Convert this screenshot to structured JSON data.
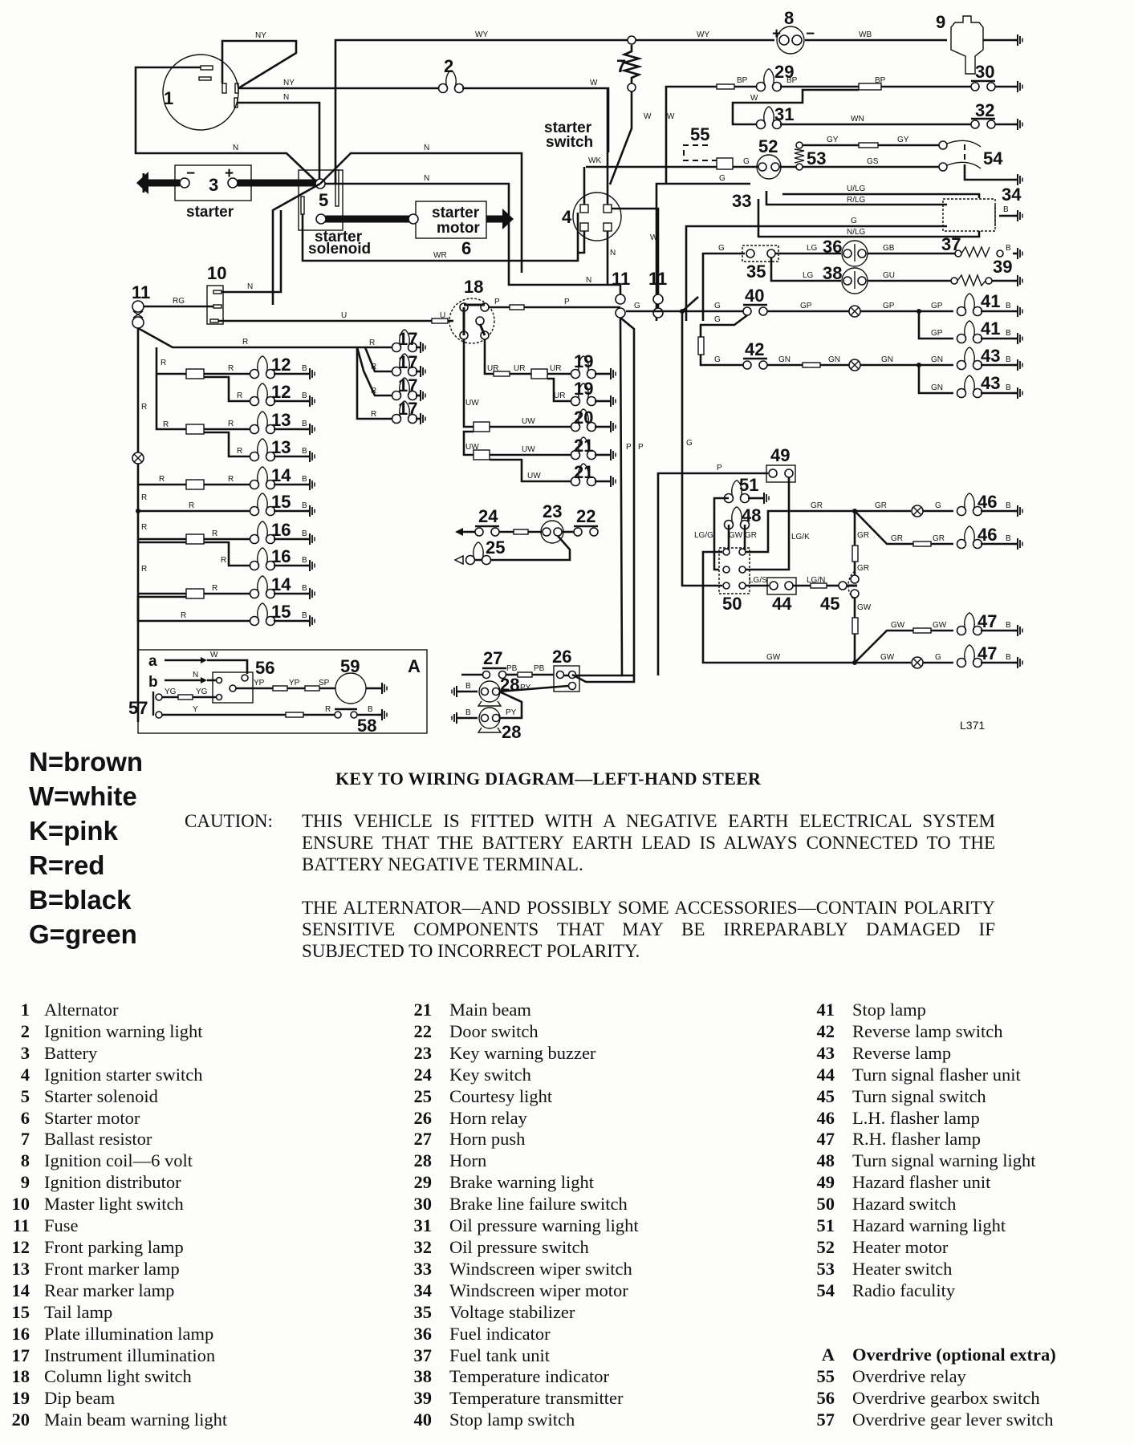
{
  "diagram": {
    "id_mark": "L371",
    "components": {
      "n1": "1",
      "n2": "2",
      "n3": "3",
      "n4": "4",
      "n5": "5",
      "n6": "6",
      "n7": "7",
      "n8": "8",
      "n9": "9",
      "n10": "10",
      "n11": "11",
      "n12": "12",
      "n13": "13",
      "n14": "14",
      "n15": "15",
      "n16": "16",
      "n17": "17",
      "n18": "18",
      "n19": "19",
      "n20": "20",
      "n21": "21",
      "n22": "22",
      "n23": "23",
      "n24": "24",
      "n25": "25",
      "n26": "26",
      "n27": "27",
      "n28": "28",
      "n29": "29",
      "n30": "30",
      "n31": "31",
      "n32": "32",
      "n33": "33",
      "n34": "34",
      "n35": "35",
      "n36": "36",
      "n37": "37",
      "n38": "38",
      "n39": "39",
      "n40": "40",
      "n41": "41",
      "n42": "42",
      "n43": "43",
      "n44": "44",
      "n45": "45",
      "n46": "46",
      "n47": "47",
      "n48": "48",
      "n49": "49",
      "n50": "50",
      "n51": "51",
      "n52": "52",
      "n53": "53",
      "n54": "54",
      "n55": "55",
      "n56": "56",
      "n57": "57",
      "n58": "58",
      "n59": "59",
      "A": "A",
      "a": "a",
      "b": "b"
    },
    "labels": {
      "starter": "starter",
      "starter_solenoid_1": "starter",
      "starter_solenoid_2": "solenoid",
      "starter_motor_1": "starter",
      "starter_motor_2": "motor",
      "starter_switch_1": "starter",
      "starter_switch_2": "switch",
      "plus": "+",
      "minus": "−"
    },
    "wire_codes": {
      "NY": "NY",
      "N": "N",
      "WY": "WY",
      "WB": "WB",
      "W": "W",
      "WK": "WK",
      "WR": "WR",
      "RG": "RG",
      "U": "U",
      "R": "R",
      "P": "P",
      "B": "B",
      "UR": "UR",
      "UW": "UW",
      "BP": "BP",
      "WN": "WN",
      "GY": "GY",
      "GS": "GS",
      "G": "G",
      "ULG": "U/LG",
      "RLG": "R/LG",
      "NLG": "N/LG",
      "LG": "LG",
      "GB": "GB",
      "GU": "GU",
      "GP": "GP",
      "GN": "GN",
      "GR": "GR",
      "GW": "GW",
      "LGG": "LG/G",
      "LGK": "LG/K",
      "LGS": "LG/S",
      "LGN": "LG/N",
      "PB": "PB",
      "PY": "PY",
      "YG": "YG",
      "YP": "YP",
      "SP": "SP",
      "Y": "Y"
    }
  },
  "legend": [
    {
      "code": "N",
      "color": "brown",
      "text": "N=brown"
    },
    {
      "code": "W",
      "color": "white",
      "text": "W=white"
    },
    {
      "code": "K",
      "color": "pink",
      "text": "K=pink"
    },
    {
      "code": "R",
      "color": "red",
      "text": "R=red"
    },
    {
      "code": "B",
      "color": "black",
      "text": "B=black"
    },
    {
      "code": "G",
      "color": "green",
      "text": "G=green"
    }
  ],
  "key": {
    "title": "KEY TO WIRING DIAGRAM—LEFT-HAND STEER",
    "caution_label": "CAUTION:",
    "caution_1": "THIS VEHICLE IS FITTED WITH A NEGATIVE EARTH ELECTRICAL SYSTEM  ENSURE THAT THE BATTERY EARTH LEAD IS ALWAYS CONNECTED TO THE BATTERY NEGATIVE TERMINAL.",
    "caution_2": "THE ALTERNATOR—AND POSSIBLY SOME ACCESSORIES—CONTAIN POLARITY SENSITIVE COMPONENTS THAT MAY BE IRREPARABLY DAMAGED IF SUBJECTED TO INCORRECT POLARITY.",
    "col1": [
      {
        "n": "1",
        "t": "Alternator"
      },
      {
        "n": "2",
        "t": "Ignition warning light"
      },
      {
        "n": "3",
        "t": "Battery"
      },
      {
        "n": "4",
        "t": "Ignition starter switch"
      },
      {
        "n": "5",
        "t": "Starter solenoid"
      },
      {
        "n": "6",
        "t": "Starter motor"
      },
      {
        "n": "7",
        "t": "Ballast resistor"
      },
      {
        "n": "8",
        "t": "Ignition coil—6 volt"
      },
      {
        "n": "9",
        "t": "Ignition distributor"
      },
      {
        "n": "10",
        "t": "Master light switch"
      },
      {
        "n": "11",
        "t": "Fuse"
      },
      {
        "n": "12",
        "t": "Front parking lamp"
      },
      {
        "n": "13",
        "t": "Front marker lamp"
      },
      {
        "n": "14",
        "t": "Rear marker lamp"
      },
      {
        "n": "15",
        "t": "Tail lamp"
      },
      {
        "n": "16",
        "t": "Plate illumination lamp"
      },
      {
        "n": "17",
        "t": "Instrument illumination"
      },
      {
        "n": "18",
        "t": "Column light switch"
      },
      {
        "n": "19",
        "t": "Dip beam"
      },
      {
        "n": "20",
        "t": "Main beam warning light"
      }
    ],
    "col2": [
      {
        "n": "21",
        "t": "Main beam"
      },
      {
        "n": "22",
        "t": "Door switch"
      },
      {
        "n": "23",
        "t": "Key warning buzzer"
      },
      {
        "n": "24",
        "t": "Key switch"
      },
      {
        "n": "25",
        "t": "Courtesy light"
      },
      {
        "n": "26",
        "t": "Horn relay"
      },
      {
        "n": "27",
        "t": "Horn push"
      },
      {
        "n": "28",
        "t": "Horn"
      },
      {
        "n": "29",
        "t": "Brake warning light"
      },
      {
        "n": "30",
        "t": "Brake line failure switch"
      },
      {
        "n": "31",
        "t": "Oil pressure warning light"
      },
      {
        "n": "32",
        "t": "Oil pressure switch"
      },
      {
        "n": "33",
        "t": "Windscreen wiper switch"
      },
      {
        "n": "34",
        "t": "Windscreen wiper motor"
      },
      {
        "n": "35",
        "t": "Voltage stabilizer"
      },
      {
        "n": "36",
        "t": "Fuel indicator"
      },
      {
        "n": "37",
        "t": "Fuel tank unit"
      },
      {
        "n": "38",
        "t": "Temperature indicator"
      },
      {
        "n": "39",
        "t": "Temperature transmitter"
      },
      {
        "n": "40",
        "t": "Stop lamp switch"
      }
    ],
    "col3": [
      {
        "n": "41",
        "t": "Stop lamp"
      },
      {
        "n": "42",
        "t": "Reverse lamp switch"
      },
      {
        "n": "43",
        "t": "Reverse lamp"
      },
      {
        "n": "44",
        "t": "Turn signal flasher unit"
      },
      {
        "n": "45",
        "t": "Turn signal switch"
      },
      {
        "n": "46",
        "t": "L.H. flasher lamp"
      },
      {
        "n": "47",
        "t": "R.H. flasher lamp"
      },
      {
        "n": "48",
        "t": "Turn signal warning light"
      },
      {
        "n": "49",
        "t": "Hazard flasher unit"
      },
      {
        "n": "50",
        "t": "Hazard switch"
      },
      {
        "n": "51",
        "t": "Hazard warning light"
      },
      {
        "n": "52",
        "t": "Heater motor"
      },
      {
        "n": "53",
        "t": "Heater switch"
      },
      {
        "n": "54",
        "t": "Radio faculity"
      }
    ],
    "col3_extra_head": {
      "n": "A",
      "t": "Overdrive (optional extra)"
    },
    "col3_extra": [
      {
        "n": "55",
        "t": "Overdrive relay"
      },
      {
        "n": "56",
        "t": "Overdrive gearbox switch"
      },
      {
        "n": "57",
        "t": "Overdrive gear lever switch"
      }
    ]
  }
}
